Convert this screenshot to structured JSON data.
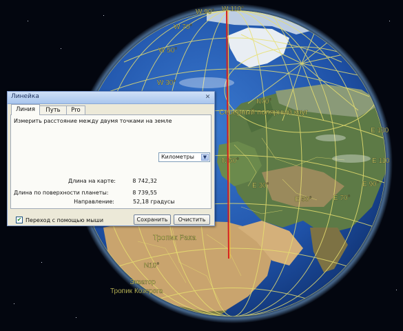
{
  "dialog": {
    "title": "Линейка",
    "close_glyph": "✕",
    "tabs": [
      {
        "label": "Линия",
        "active": true
      },
      {
        "label": "Путь",
        "active": false
      },
      {
        "label": "Pro",
        "active": false
      }
    ],
    "description": "Измерить расстояние между двумя точками на земле",
    "map_length_label": "Длина на карте:",
    "map_length_value": "8 742,32",
    "unit_selected": "Километры",
    "ground_length_label": "Длина по поверхности планеты:",
    "ground_length_value": "8 739,55",
    "heading_label": "Направление:",
    "heading_value": "52,18 градусы",
    "mouse_nav_label": "Переход с помощью мыши",
    "mouse_nav_checked": true,
    "save_label": "Сохранить",
    "clear_label": "Очистить"
  },
  "globe_labels": {
    "w90": "W 90°",
    "w110": "W 110°",
    "w70": "W 70°",
    "w50": "W 50°",
    "w30": "W 30°",
    "n70": "N70°",
    "arctic_circle": "Северный полярный круг",
    "e130": "E 130",
    "e110": "E 110",
    "e90": "E 90°",
    "n50": "N 50°",
    "e30": "E 30°",
    "e50": "E 50°",
    "e70": "E 70°",
    "tropic_cancer": "Тропик Рака",
    "n10": "N10°",
    "equator": "Экватор",
    "tropic_capricorn": "Тропик Козерога"
  },
  "colors": {
    "grid": "#e8e070",
    "label": "#f5ef6a",
    "ocean": "#1f52a8",
    "ruler_line": "#d62020"
  }
}
